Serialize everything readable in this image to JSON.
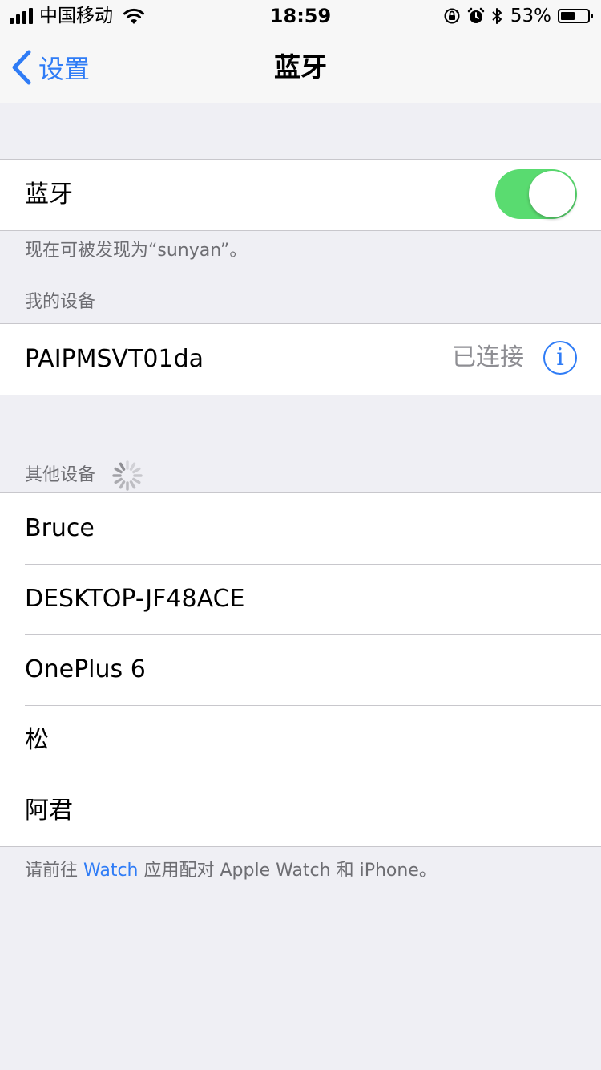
{
  "status_bar": {
    "carrier": "中国移动",
    "time": "18:59",
    "battery_percent": "53%",
    "battery_level": 0.53,
    "icons": [
      "signal-icon",
      "wifi-icon",
      "orientation-lock-icon",
      "alarm-icon",
      "bluetooth-icon",
      "battery-icon"
    ]
  },
  "nav": {
    "back_label": "设置",
    "title": "蓝牙"
  },
  "bluetooth": {
    "label": "蓝牙",
    "enabled": true,
    "discoverable_note": "现在可被发现为“sunyan”。"
  },
  "my_devices": {
    "header": "我的设备",
    "items": [
      {
        "name": "PAIPMSVT01da",
        "status": "已连接"
      }
    ]
  },
  "other_devices": {
    "header": "其他设备",
    "items": [
      {
        "name": "Bruce"
      },
      {
        "name": "DESKTOP-JF48ACE"
      },
      {
        "name": "OnePlus 6"
      },
      {
        "name": "松"
      },
      {
        "name": "阿君"
      }
    ]
  },
  "footer": {
    "prefix": "请前往 ",
    "link": "Watch",
    "suffix": " 应用配对 Apple Watch 和 iPhone。"
  },
  "colors": {
    "accent": "#2f7cf6",
    "toggle_on": "#4cd964",
    "background": "#efeff4"
  }
}
